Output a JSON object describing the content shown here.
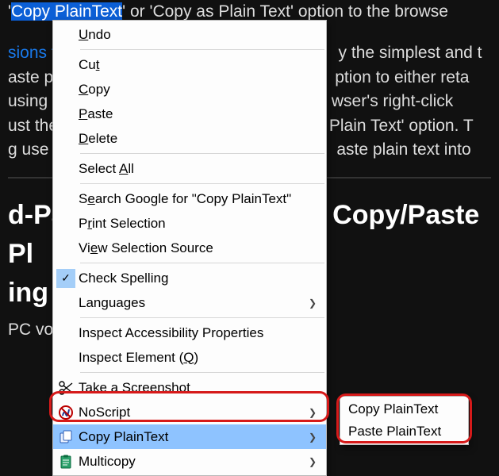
{
  "background": {
    "line1_pre": "'",
    "line1_sel": "Copy PlainText",
    "line1_post": "' or 'Copy as Plain Text' option to the browse",
    "para2_link": "sions f",
    "para2_l1_rest_frag": "y the simplest and t",
    "para2_l2_a": "aste p",
    "para2_l2_b": "ption to either reta",
    "para2_l3_a": "using t",
    "para2_l3_b": "wser's right-click",
    "para2_l4_a": "ust the",
    "para2_l4_b": " Plain Text' option. T",
    "para2_l5_a": "g use",
    "para2_l5_b": "aste plain text into",
    "heading_a": "d-Pa",
    "heading_b": " Copy/Paste Pl",
    "heading_c": "ing",
    "last": "PC vo"
  },
  "menu": {
    "undo": "Undo",
    "cut": "Cut",
    "copy": "Copy",
    "paste": "Paste",
    "delete": "Delete",
    "select_all_pre": "Select ",
    "select_all_u": "A",
    "select_all_post": "ll",
    "search_pre": "S",
    "search_u": "e",
    "search_post": "arch Google for \"Copy PlainText\"",
    "print_pre": "P",
    "print_u": "r",
    "print_post": "int Selection",
    "viewsel_pre": "Vi",
    "viewsel_u": "e",
    "viewsel_post": "w Selection Source",
    "spelling_pre": "Check Spellin",
    "spelling_u": "g",
    "languages": "Languages",
    "a11y": "Inspect Accessibility Properties",
    "inspect_pre": "Inspect Element (",
    "inspect_u": "Q",
    "inspect_post": ")",
    "screenshot": "Take a Screenshot",
    "noscript": "NoScript",
    "copyplain": "Copy PlainText",
    "multicopy": "Multicopy"
  },
  "submenu": {
    "copy": "Copy PlainText",
    "paste": "Paste PlainText"
  }
}
